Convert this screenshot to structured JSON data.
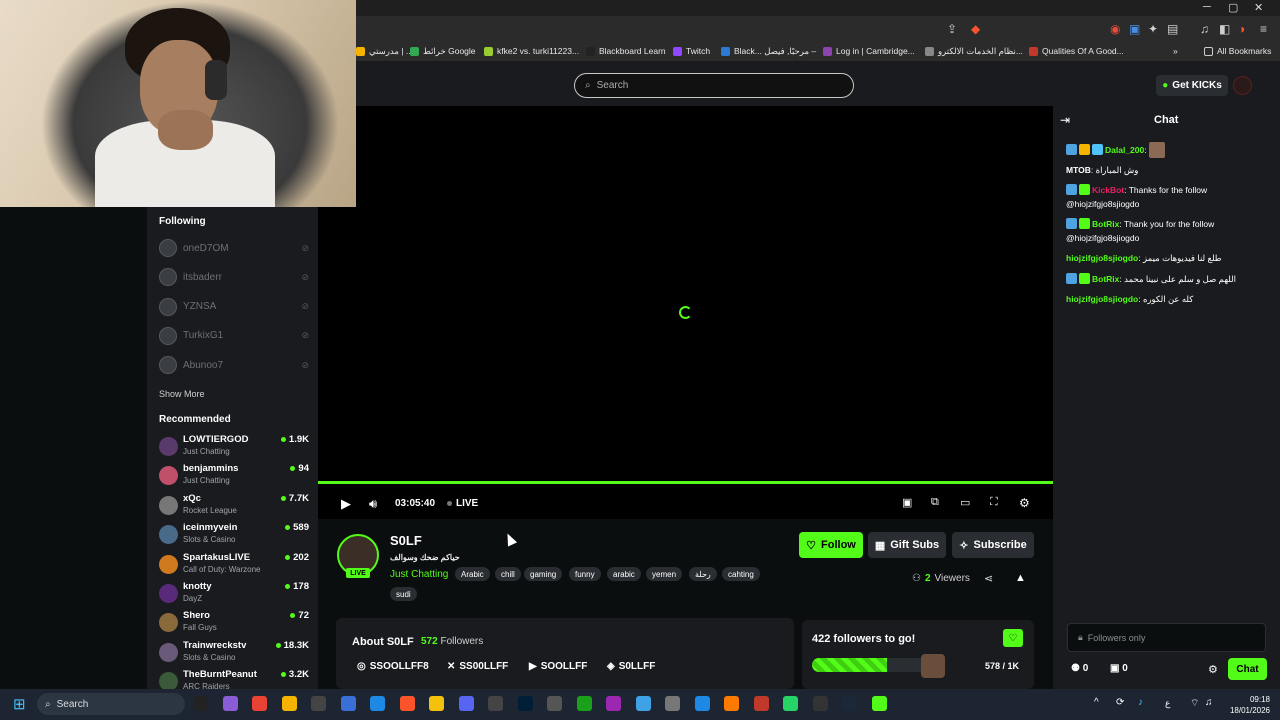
{
  "browser": {
    "bookmarks": [
      {
        "label": "مدرستي | ...",
        "color": "#f4b400"
      },
      {
        "label": "خرائط Google",
        "color": "#34a853"
      },
      {
        "label": "kfke2 vs. turki11223...",
        "color": "#9acd32"
      },
      {
        "label": "Blackboard Learn",
        "color": "#222"
      },
      {
        "label": "Twitch",
        "color": "#9146ff"
      },
      {
        "label": "Black... مرحبًا, فيصل –",
        "color": "#2b7bd4"
      },
      {
        "label": "Log in | Cambridge...",
        "color": "#8e44ad"
      },
      {
        "label": "نظام الخدمات الالكترو...",
        "color": "#888"
      },
      {
        "label": "Qualities Of A Good...",
        "color": "#c0392b"
      }
    ],
    "all_bookmarks": "All Bookmarks"
  },
  "header": {
    "search_placeholder": "Search",
    "get_kicks": "Get KICKs"
  },
  "sidebar": {
    "following_heading": "Following",
    "following": [
      "oneD7OM",
      "itsbaderr",
      "YZNSA",
      "TurkixG1",
      "Abunoo7"
    ],
    "show_more": "Show More",
    "recommended_heading": "Recommended",
    "recommended": [
      {
        "name": "LOWTIERGOD",
        "category": "Just Chatting",
        "viewers": "1.9K",
        "color": "#5a3a6a"
      },
      {
        "name": "benjammins",
        "category": "Just Chatting",
        "viewers": "94",
        "color": "#c0506a"
      },
      {
        "name": "xQc",
        "category": "Rocket League",
        "viewers": "7.7K",
        "color": "#777777"
      },
      {
        "name": "iceinmyvein",
        "category": "Slots & Casino",
        "viewers": "589",
        "color": "#4a6a8a"
      },
      {
        "name": "SpartakusLIVE",
        "category": "Call of Duty: Warzone",
        "viewers": "202",
        "color": "#d07a20"
      },
      {
        "name": "knotty",
        "category": "DayZ",
        "viewers": "178",
        "color": "#5a2a7a"
      },
      {
        "name": "Shero",
        "category": "Fall Guys",
        "viewers": "72",
        "color": "#8a6a3a"
      },
      {
        "name": "Trainwreckstv",
        "category": "Slots & Casino",
        "viewers": "18.3K",
        "color": "#6a5a7a"
      },
      {
        "name": "TheBurntPeanut",
        "category": "ARC Raiders",
        "viewers": "3.2K",
        "color": "#3a5a3a"
      }
    ]
  },
  "player": {
    "time": "03:05:40",
    "live": "LIVE",
    "progress": 1.0
  },
  "channel": {
    "name": "S0LF",
    "title": "حياكم ضحك وسوالف",
    "category": "Just Chatting",
    "live_badge": "LIVE",
    "tags": [
      "Arabic",
      "chill",
      "gaming",
      "funny",
      "arabic",
      "yemen",
      "رحلة",
      "cahting",
      "sudi"
    ],
    "follow": "Follow",
    "gift_subs": "Gift Subs",
    "subscribe": "Subscribe",
    "viewers_count": "2",
    "viewers_label": "Viewers"
  },
  "about": {
    "title": "About S0LF",
    "followers_count": "572",
    "followers_label": "Followers",
    "socials": [
      {
        "icon": "instagram-icon",
        "label": "SSOOLLFF8"
      },
      {
        "icon": "x-icon",
        "label": "SS00LLFF"
      },
      {
        "icon": "youtube-icon",
        "label": "SOOLLFF"
      },
      {
        "icon": "discord-icon",
        "label": "S0LLFF"
      }
    ]
  },
  "goal": {
    "title": "422 followers to go!",
    "count": "578 / 1K",
    "fraction": 0.578
  },
  "chat": {
    "title": "Chat",
    "messages": [
      {
        "user": "Dalal_200",
        "color": "#53fc18",
        "text": ""
      },
      {
        "user": "MTOB",
        "color": "#ffffff",
        "text": "وش المباراة"
      },
      {
        "user": "KickBot",
        "color": "#e91e63",
        "text": "Thanks for the follow @hiojzifgjo8sjiogdo"
      },
      {
        "user": "BotRix",
        "color": "#53fc18",
        "text": "Thank you for the follow @hiojzifgjo8sjiogdo"
      },
      {
        "user": "hiojzifgjo8sjiogdo",
        "color": "#53fc18",
        "text": "طلع لنا فيديوهات ميمز"
      },
      {
        "user": "BotRix",
        "color": "#53fc18",
        "text": "اللهم صل و سلم على نبينا محمد"
      },
      {
        "user": "hiojzifgjo8sjiogdo",
        "color": "#53fc18",
        "text": "كله عن الكوره"
      }
    ],
    "input_placeholder": "Followers only",
    "stat_users": "0",
    "stat_other": "0",
    "send": "Chat"
  },
  "taskbar": {
    "search": "Search",
    "time": "09:18",
    "date": "18/01/2026",
    "lang": "ع"
  },
  "accent_color": "#53fc18"
}
